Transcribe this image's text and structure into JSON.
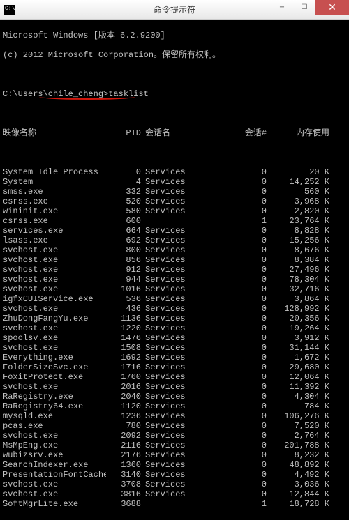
{
  "window": {
    "title": "命令提示符"
  },
  "intro": {
    "line1": "Microsoft Windows [版本 6.2.9200]",
    "line2": "(c) 2012 Microsoft Corporation。保留所有权利。"
  },
  "prompt": "C:\\Users\\chile_cheng>tasklist",
  "headers": {
    "name": "映像名称",
    "pid": "PID",
    "session": "会话名",
    "session_num": "会话#",
    "memory": "内存使用"
  },
  "separators": {
    "name": "=========================",
    "pid": "========",
    "session": "================",
    "session_num": "===========",
    "memory": "============"
  },
  "processes": [
    {
      "name": "System Idle Process",
      "pid": "0",
      "sess": "Services",
      "sn": "0",
      "mem": "20 K"
    },
    {
      "name": "System",
      "pid": "4",
      "sess": "Services",
      "sn": "0",
      "mem": "14,252 K"
    },
    {
      "name": "smss.exe",
      "pid": "332",
      "sess": "Services",
      "sn": "0",
      "mem": "560 K"
    },
    {
      "name": "csrss.exe",
      "pid": "520",
      "sess": "Services",
      "sn": "0",
      "mem": "3,968 K"
    },
    {
      "name": "wininit.exe",
      "pid": "580",
      "sess": "Services",
      "sn": "0",
      "mem": "2,820 K"
    },
    {
      "name": "csrss.exe",
      "pid": "600",
      "sess": "",
      "sn": "1",
      "mem": "23,764 K"
    },
    {
      "name": "services.exe",
      "pid": "664",
      "sess": "Services",
      "sn": "0",
      "mem": "8,828 K"
    },
    {
      "name": "lsass.exe",
      "pid": "692",
      "sess": "Services",
      "sn": "0",
      "mem": "15,256 K"
    },
    {
      "name": "svchost.exe",
      "pid": "800",
      "sess": "Services",
      "sn": "0",
      "mem": "8,676 K"
    },
    {
      "name": "svchost.exe",
      "pid": "856",
      "sess": "Services",
      "sn": "0",
      "mem": "8,384 K"
    },
    {
      "name": "svchost.exe",
      "pid": "912",
      "sess": "Services",
      "sn": "0",
      "mem": "27,496 K"
    },
    {
      "name": "svchost.exe",
      "pid": "944",
      "sess": "Services",
      "sn": "0",
      "mem": "78,304 K"
    },
    {
      "name": "svchost.exe",
      "pid": "1016",
      "sess": "Services",
      "sn": "0",
      "mem": "32,716 K"
    },
    {
      "name": "igfxCUIService.exe",
      "pid": "536",
      "sess": "Services",
      "sn": "0",
      "mem": "3,864 K"
    },
    {
      "name": "svchost.exe",
      "pid": "436",
      "sess": "Services",
      "sn": "0",
      "mem": "128,992 K"
    },
    {
      "name": "ZhuDongFangYu.exe",
      "pid": "1136",
      "sess": "Services",
      "sn": "0",
      "mem": "20,356 K"
    },
    {
      "name": "svchost.exe",
      "pid": "1220",
      "sess": "Services",
      "sn": "0",
      "mem": "19,264 K"
    },
    {
      "name": "spoolsv.exe",
      "pid": "1476",
      "sess": "Services",
      "sn": "0",
      "mem": "3,912 K"
    },
    {
      "name": "svchost.exe",
      "pid": "1508",
      "sess": "Services",
      "sn": "0",
      "mem": "31,144 K"
    },
    {
      "name": "Everything.exe",
      "pid": "1692",
      "sess": "Services",
      "sn": "0",
      "mem": "1,672 K"
    },
    {
      "name": "FolderSizeSvc.exe",
      "pid": "1716",
      "sess": "Services",
      "sn": "0",
      "mem": "29,680 K"
    },
    {
      "name": "FoxitProtect.exe",
      "pid": "1760",
      "sess": "Services",
      "sn": "0",
      "mem": "12,064 K"
    },
    {
      "name": "svchost.exe",
      "pid": "2016",
      "sess": "Services",
      "sn": "0",
      "mem": "11,392 K"
    },
    {
      "name": "RaRegistry.exe",
      "pid": "2040",
      "sess": "Services",
      "sn": "0",
      "mem": "4,304 K"
    },
    {
      "name": "RaRegistry64.exe",
      "pid": "1120",
      "sess": "Services",
      "sn": "0",
      "mem": "784 K"
    },
    {
      "name": "mysqld.exe",
      "pid": "1236",
      "sess": "Services",
      "sn": "0",
      "mem": "106,276 K"
    },
    {
      "name": "pcas.exe",
      "pid": "780",
      "sess": "Services",
      "sn": "0",
      "mem": "7,520 K"
    },
    {
      "name": "svchost.exe",
      "pid": "2092",
      "sess": "Services",
      "sn": "0",
      "mem": "2,764 K"
    },
    {
      "name": "MsMpEng.exe",
      "pid": "2116",
      "sess": "Services",
      "sn": "0",
      "mem": "201,788 K"
    },
    {
      "name": "wubizsrv.exe",
      "pid": "2176",
      "sess": "Services",
      "sn": "0",
      "mem": "8,232 K"
    },
    {
      "name": "SearchIndexer.exe",
      "pid": "1360",
      "sess": "Services",
      "sn": "0",
      "mem": "48,892 K"
    },
    {
      "name": "PresentationFontCache.exe",
      "pid": "3140",
      "sess": "Services",
      "sn": "0",
      "mem": "4,492 K"
    },
    {
      "name": "svchost.exe",
      "pid": "3708",
      "sess": "Services",
      "sn": "0",
      "mem": "3,036 K"
    },
    {
      "name": "svchost.exe",
      "pid": "3816",
      "sess": "Services",
      "sn": "0",
      "mem": "12,844 K"
    },
    {
      "name": "SoftMgrLite.exe",
      "pid": "3688",
      "sess": "",
      "sn": "1",
      "mem": "18,728 K"
    }
  ]
}
